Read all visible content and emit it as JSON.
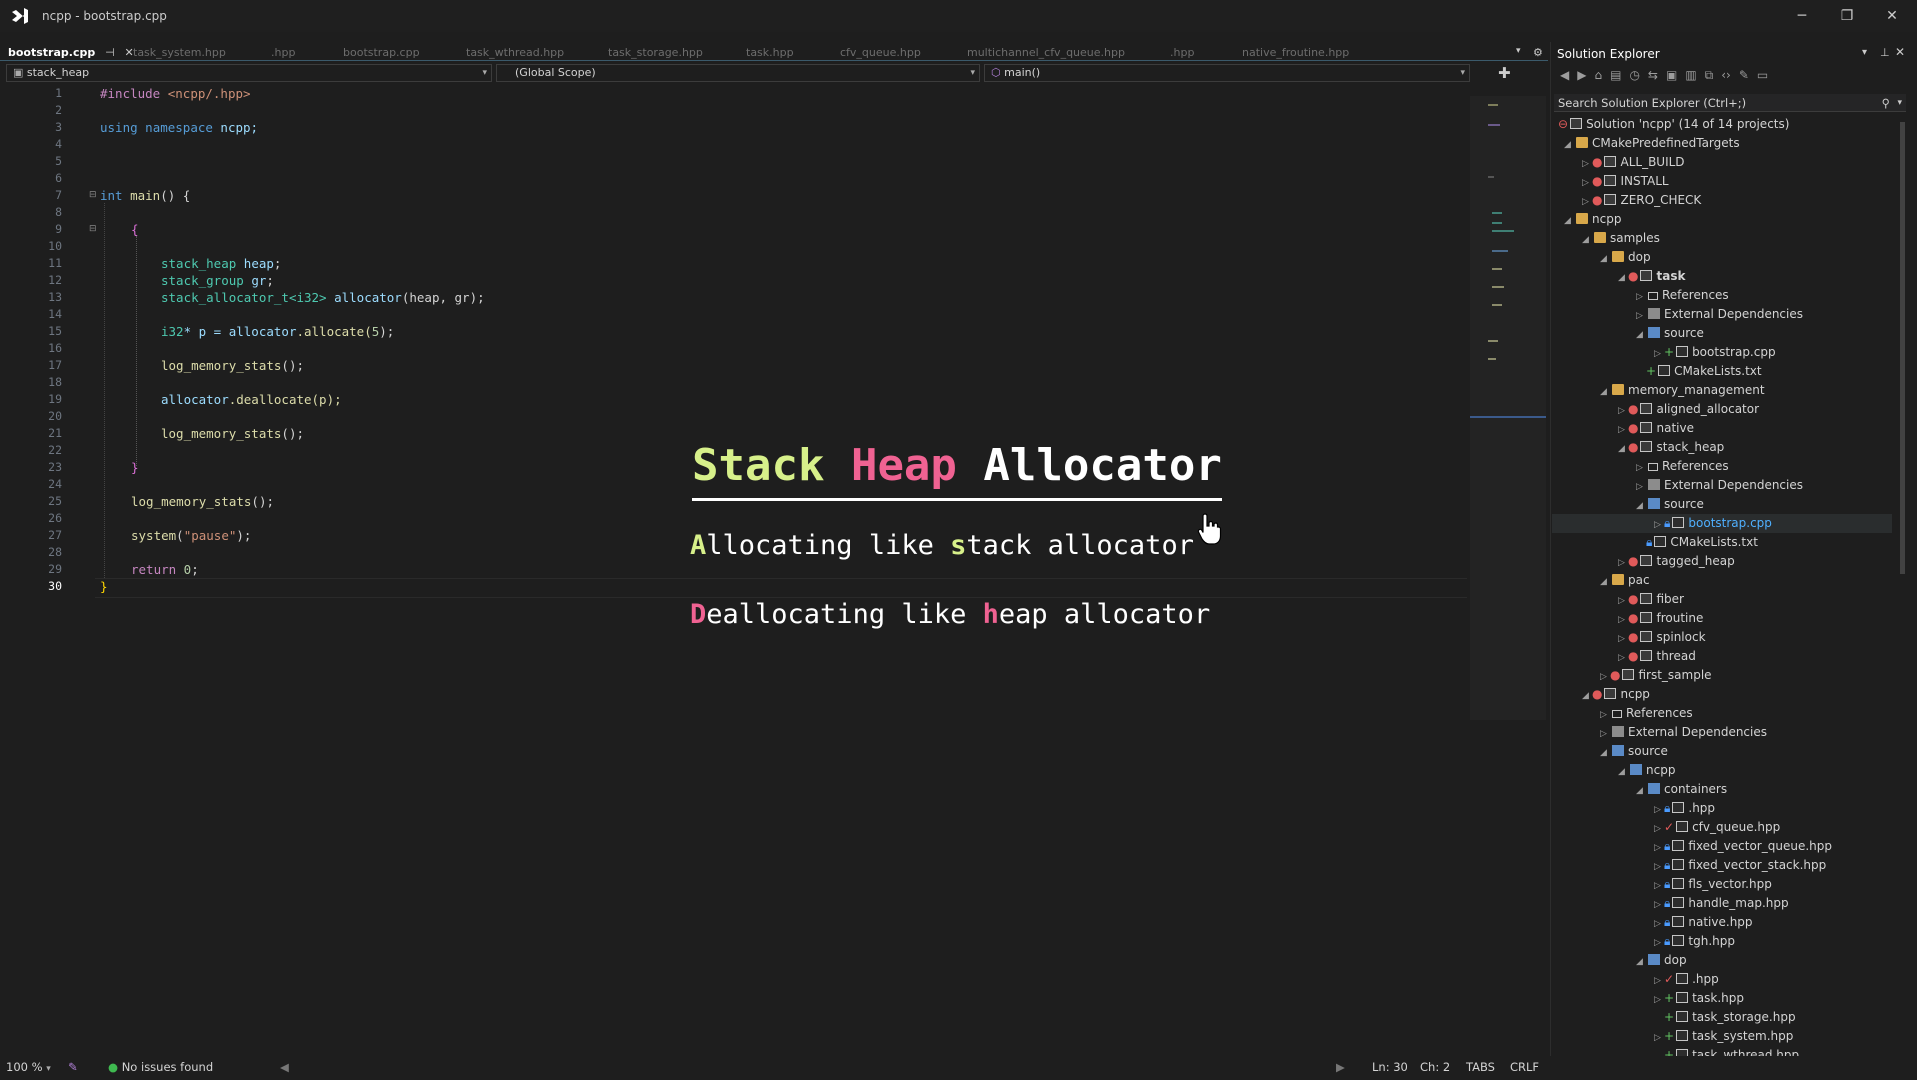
{
  "window": {
    "title": "ncpp - bootstrap.cpp",
    "minimize": "─",
    "restore": "❐",
    "close": "✕"
  },
  "tabs": [
    {
      "label": "bootstrap.cpp",
      "active": true,
      "pin": "⊣",
      "close": "✕"
    },
    {
      "label": "task_system.hpp"
    },
    {
      "label": ".hpp"
    },
    {
      "label": "bootstrap.cpp"
    },
    {
      "label": "task_wthread.hpp"
    },
    {
      "label": "task_storage.hpp"
    },
    {
      "label": "task.hpp"
    },
    {
      "label": "cfv_queue.hpp"
    },
    {
      "label": "multichannel_cfv_queue.hpp"
    },
    {
      "label": ".hpp"
    },
    {
      "label": "native_froutine.hpp"
    }
  ],
  "navbar": {
    "project": "stack_heap",
    "scope": "(Global Scope)",
    "member": "main()"
  },
  "code": {
    "line_numbers": [
      "1",
      "2",
      "3",
      "4",
      "5",
      "6",
      "7",
      "8",
      "9",
      "10",
      "11",
      "12",
      "13",
      "14",
      "15",
      "16",
      "17",
      "18",
      "19",
      "20",
      "21",
      "22",
      "23",
      "24",
      "25",
      "26",
      "27",
      "28",
      "29",
      "30"
    ],
    "current_line": "30",
    "l1": {
      "a": "#include",
      "b": " <ncpp/.hpp>"
    },
    "l3": {
      "a": "using",
      "b": " namespace",
      "c": " ncpp;"
    },
    "l7": {
      "a": "int",
      "b": " main",
      "c": "() {"
    },
    "l9": "{",
    "l11": {
      "a": "stack_heap",
      "b": " heap",
      "c": ";"
    },
    "l12": {
      "a": "stack_group",
      "b": " gr",
      "c": ";"
    },
    "l13": {
      "a": "stack_allocator_t",
      "b": "<i32>",
      "c": " allocator",
      "d": "(heap, gr);"
    },
    "l15": {
      "a": "i32",
      "b": "* p = ",
      "c": "allocator",
      "d": ".allocate(",
      "e": "5",
      "f": ");"
    },
    "l17": {
      "a": "log_memory_stats",
      "b": "();"
    },
    "l19": {
      "a": "allocator",
      "b": ".deallocate(p);"
    },
    "l21": {
      "a": "log_memory_stats",
      "b": "();"
    },
    "l23": "}",
    "l25": {
      "a": "log_memory_stats",
      "b": "();"
    },
    "l27": {
      "a": "system",
      "b": "(",
      "c": "\"pause\"",
      "d": ");"
    },
    "l29": {
      "a": "return",
      "b": " 0",
      "c": ";"
    },
    "l30": "}"
  },
  "overlay": {
    "title_stack": "Stack",
    "title_heap": "Heap",
    "title_allocator": "Allocator",
    "line1_a": "A",
    "line1_b": "llocating like ",
    "line1_c": "s",
    "line1_d": "tack allocator",
    "line2_a": "D",
    "line2_b": "eallocating like ",
    "line2_c": "h",
    "line2_d": "eap allocator",
    "colors": {
      "stack": "#d7f08a",
      "heap": "#f06292",
      "text": "#ffffff"
    }
  },
  "solution_explorer": {
    "title": "Solution Explorer",
    "search_placeholder": "Search Solution Explorer (Ctrl+;)",
    "items": [
      {
        "label": "Solution 'ncpp' (14 of 14 projects)",
        "icon": "solution-icon",
        "arrow": ""
      },
      {
        "label": "CMakePredefinedTargets",
        "icon": "folder-icon",
        "arrow": "◢"
      },
      {
        "label": "ALL_BUILD",
        "icon": "project-icon",
        "arrow": "▷"
      },
      {
        "label": "INSTALL",
        "icon": "project-icon",
        "arrow": "▷"
      },
      {
        "label": "ZERO_CHECK",
        "icon": "project-icon",
        "arrow": "▷"
      },
      {
        "label": "ncpp",
        "icon": "folder-icon",
        "arrow": "◢"
      },
      {
        "label": "samples",
        "icon": "folder-icon",
        "arrow": "◢"
      },
      {
        "label": "dop",
        "icon": "folder-icon",
        "arrow": "◢"
      },
      {
        "label": "task",
        "icon": "project-icon",
        "arrow": "◢"
      },
      {
        "label": "References",
        "icon": "references-icon",
        "arrow": "▷"
      },
      {
        "label": "External Dependencies",
        "icon": "dependencies-icon",
        "arrow": "▷"
      },
      {
        "label": "source",
        "icon": "source-folder-icon",
        "arrow": "◢"
      },
      {
        "label": "bootstrap.cpp",
        "icon": "cpp-file-icon",
        "arrow": "▷"
      },
      {
        "label": "CMakeLists.txt",
        "icon": "text-file-icon",
        "arrow": ""
      },
      {
        "label": "memory_management",
        "icon": "folder-icon",
        "arrow": "◢"
      },
      {
        "label": "aligned_allocator",
        "icon": "project-icon",
        "arrow": "▷"
      },
      {
        "label": "native",
        "icon": "project-icon",
        "arrow": "▷"
      },
      {
        "label": "stack_heap",
        "icon": "project-icon",
        "arrow": "◢"
      },
      {
        "label": "References",
        "icon": "references-icon",
        "arrow": "▷"
      },
      {
        "label": "External Dependencies",
        "icon": "dependencies-icon",
        "arrow": "▷"
      },
      {
        "label": "source",
        "icon": "source-folder-icon",
        "arrow": "◢"
      },
      {
        "label": "bootstrap.cpp",
        "icon": "cpp-file-icon",
        "arrow": "▷"
      },
      {
        "label": "CMakeLists.txt",
        "icon": "text-file-icon",
        "arrow": ""
      },
      {
        "label": "tagged_heap",
        "icon": "project-icon",
        "arrow": "▷"
      },
      {
        "label": "pac",
        "icon": "folder-icon",
        "arrow": "◢"
      },
      {
        "label": "fiber",
        "icon": "project-icon",
        "arrow": "▷"
      },
      {
        "label": "froutine",
        "icon": "project-icon",
        "arrow": "▷"
      },
      {
        "label": "spinlock",
        "icon": "project-icon",
        "arrow": "▷"
      },
      {
        "label": "thread",
        "icon": "project-icon",
        "arrow": "▷"
      },
      {
        "label": "first_sample",
        "icon": "project-icon",
        "arrow": "▷"
      },
      {
        "label": "ncpp",
        "icon": "project-icon",
        "arrow": "◢"
      },
      {
        "label": "References",
        "icon": "references-icon",
        "arrow": "▷"
      },
      {
        "label": "External Dependencies",
        "icon": "dependencies-icon",
        "arrow": "▷"
      },
      {
        "label": "source",
        "icon": "source-folder-icon",
        "arrow": "◢"
      },
      {
        "label": "ncpp",
        "icon": "source-folder-icon",
        "arrow": "◢"
      },
      {
        "label": "containers",
        "icon": "source-folder-icon",
        "arrow": "◢"
      },
      {
        "label": ".hpp",
        "icon": "header-file-icon",
        "arrow": "▷"
      },
      {
        "label": "cfv_queue.hpp",
        "icon": "header-file-icon",
        "arrow": "▷"
      },
      {
        "label": "fixed_vector_queue.hpp",
        "icon": "header-file-icon",
        "arrow": "▷"
      },
      {
        "label": "fixed_vector_stack.hpp",
        "icon": "header-file-icon",
        "arrow": "▷"
      },
      {
        "label": "fls_vector.hpp",
        "icon": "header-file-icon",
        "arrow": "▷"
      },
      {
        "label": "handle_map.hpp",
        "icon": "header-file-icon",
        "arrow": "▷"
      },
      {
        "label": "native.hpp",
        "icon": "header-file-icon",
        "arrow": "▷"
      },
      {
        "label": "tgh.hpp",
        "icon": "header-file-icon",
        "arrow": "▷"
      },
      {
        "label": "dop",
        "icon": "source-folder-icon",
        "arrow": "◢"
      },
      {
        "label": ".hpp",
        "icon": "header-file-icon",
        "arrow": "▷"
      },
      {
        "label": "task.hpp",
        "icon": "header-file-icon",
        "arrow": "▷"
      },
      {
        "label": "task_storage.hpp",
        "icon": "header-file-icon",
        "arrow": ""
      },
      {
        "label": "task_system.hpp",
        "icon": "header-file-icon",
        "arrow": "▷"
      },
      {
        "label": "task_wthread.hpp",
        "icon": "header-file-icon",
        "arrow": ""
      }
    ]
  },
  "statusbar": {
    "zoom": "100 %",
    "issues": "No issues found",
    "line": "Ln: 30",
    "col": "Ch: 2",
    "indent": "TABS",
    "eol": "CRLF"
  }
}
